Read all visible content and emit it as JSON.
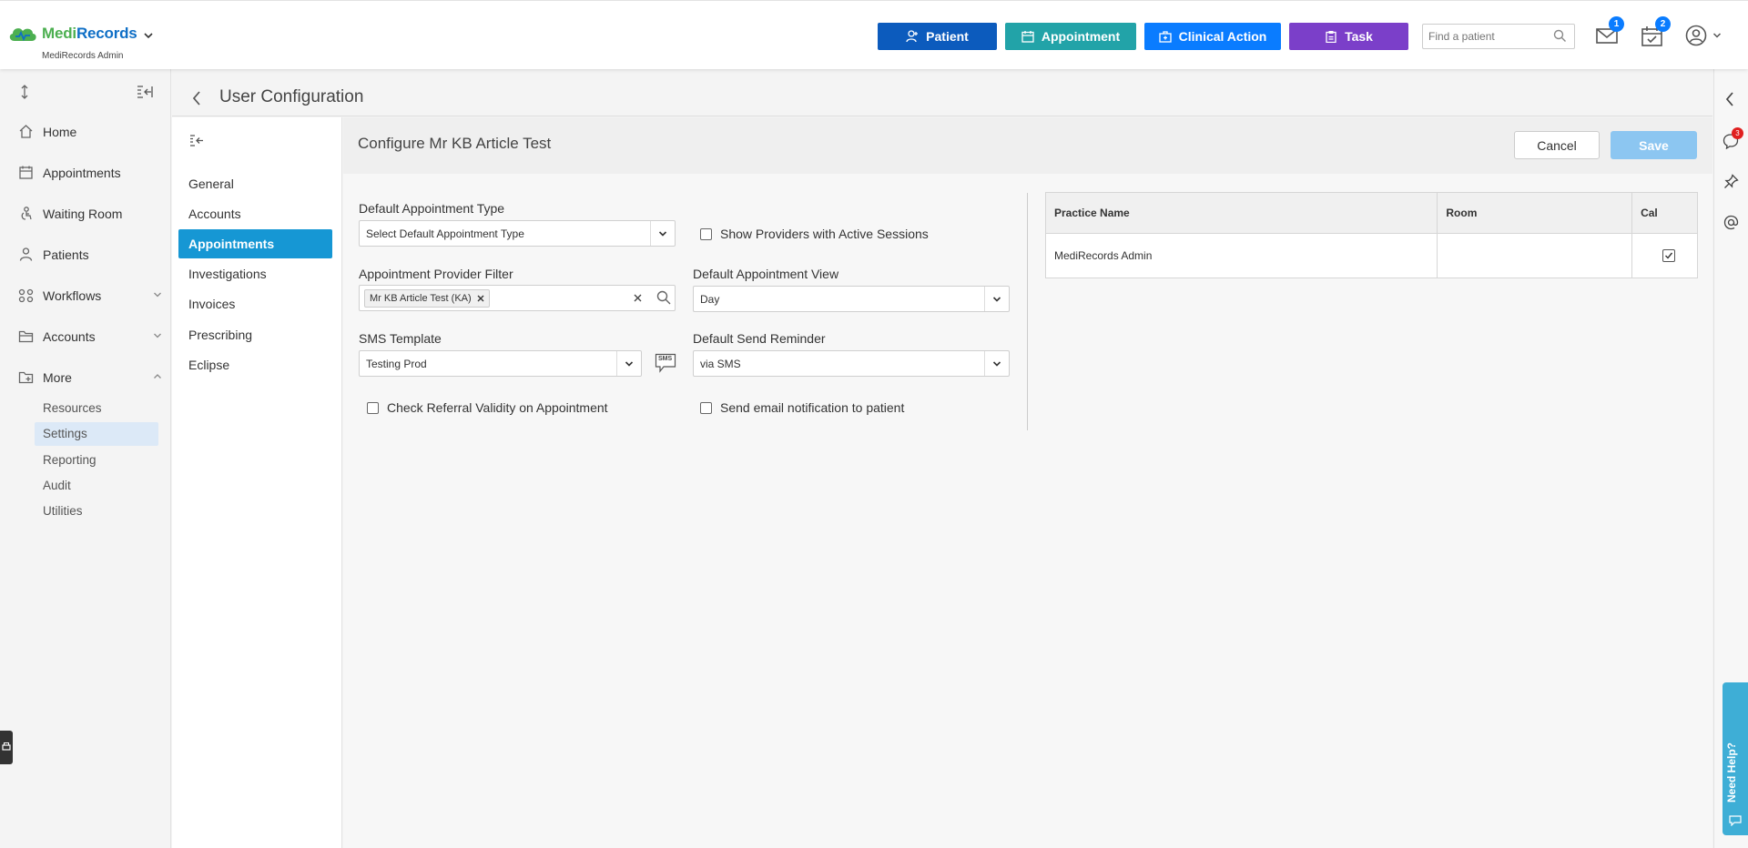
{
  "app": {
    "brand_medi": "Medi",
    "brand_records": "Records",
    "subtitle": "MediRecords Admin"
  },
  "header": {
    "buttons": {
      "patient": "Patient",
      "appointment": "Appointment",
      "clinical_action": "Clinical Action",
      "task": "Task"
    },
    "search_placeholder": "Find a patient",
    "mail_badge": "1",
    "tasks_badge": "2",
    "colors": {
      "patient": "#0c5bbd",
      "appointment": "#22a3a8",
      "clinical_action": "#0a7cff",
      "task": "#7b3fc9"
    }
  },
  "sidebar": {
    "items": [
      {
        "label": "Home",
        "icon": "home-icon"
      },
      {
        "label": "Appointments",
        "icon": "calendar-icon"
      },
      {
        "label": "Waiting Room",
        "icon": "waiting-room-icon"
      },
      {
        "label": "Patients",
        "icon": "patients-icon"
      },
      {
        "label": "Workflows",
        "icon": "workflows-icon"
      },
      {
        "label": "Accounts",
        "icon": "folder-icon"
      },
      {
        "label": "More",
        "icon": "more-icon"
      }
    ],
    "more_items": [
      "Resources",
      "Settings",
      "Reporting",
      "Audit",
      "Utilities"
    ],
    "active_more_item": "Settings"
  },
  "page": {
    "title": "User Configuration",
    "config_title": "Configure Mr KB Article Test",
    "cancel_label": "Cancel",
    "save_label": "Save"
  },
  "subnav": {
    "items": [
      "General",
      "Accounts",
      "Appointments",
      "Investigations",
      "Invoices",
      "Prescribing",
      "Eclipse"
    ],
    "active": "Appointments"
  },
  "form": {
    "default_appt_type_label": "Default Appointment Type",
    "default_appt_type_value": "Select Default Appointment Type",
    "show_providers_label": "Show Providers with Active Sessions",
    "provider_filter_label": "Appointment Provider Filter",
    "provider_filter_tag": "Mr KB Article Test (KA)",
    "default_view_label": "Default Appointment View",
    "default_view_value": "Day",
    "sms_template_label": "SMS Template",
    "sms_template_value": "Testing Prod",
    "sms_icon_text": "SMS",
    "send_reminder_label": "Default Send Reminder",
    "send_reminder_value": "via SMS",
    "check_referral_label": "Check Referral Validity on Appointment",
    "send_email_label": "Send email notification to patient"
  },
  "practice_table": {
    "headers": [
      "Practice Name",
      "Room",
      "Cal"
    ],
    "rows": [
      {
        "practice": "MediRecords Admin",
        "room": "",
        "cal_checked": true
      }
    ]
  },
  "right_rail": {
    "notification_badge": "3",
    "need_help": "Need Help?"
  }
}
